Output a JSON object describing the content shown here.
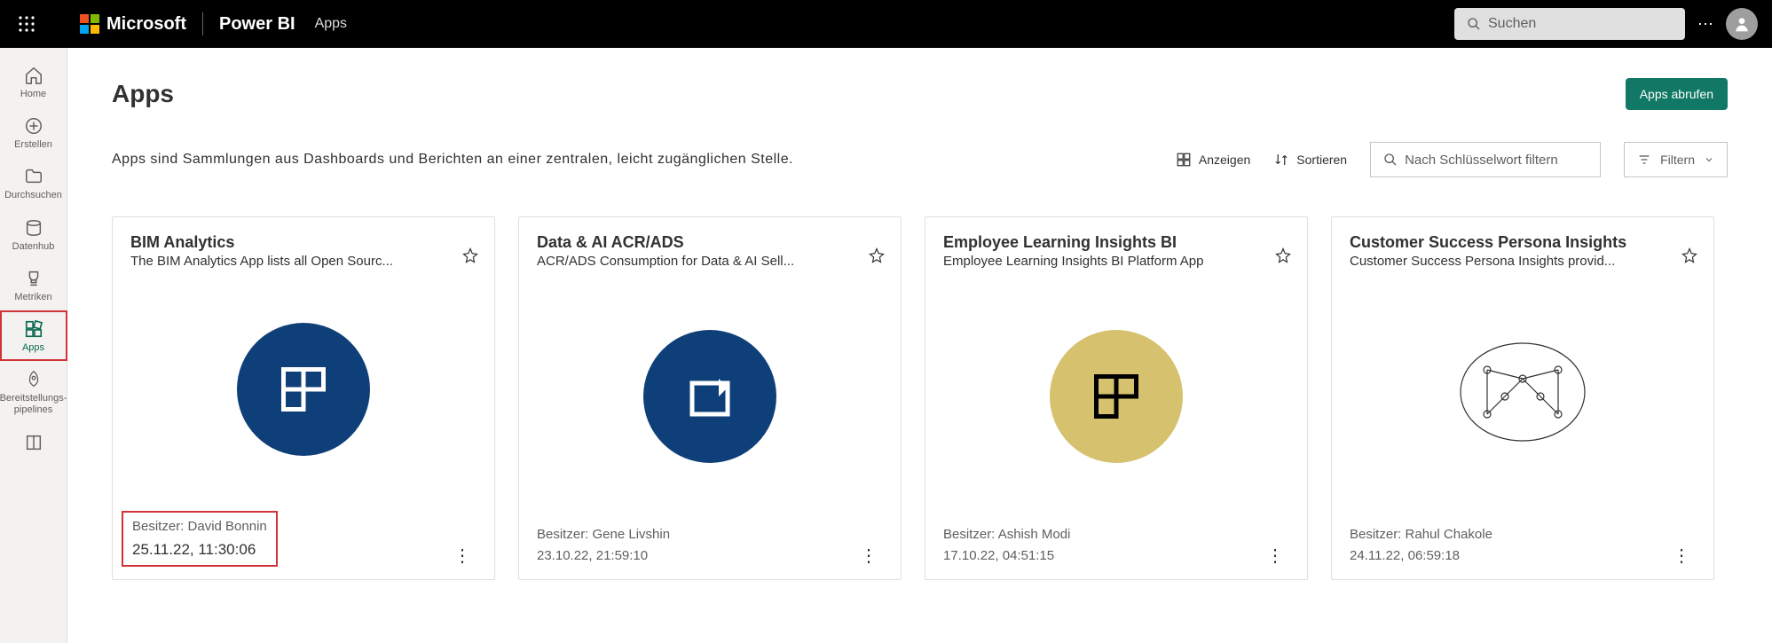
{
  "topbar": {
    "brand": "Microsoft",
    "product": "Power BI",
    "section": "Apps",
    "search_placeholder": "Suchen"
  },
  "rail": {
    "home": "Home",
    "create": "Erstellen",
    "browse": "Durchsuchen",
    "datahub": "Datenhub",
    "metrics": "Metriken",
    "apps": "Apps",
    "pipelines": "Bereitstellungs-\npipelines"
  },
  "page": {
    "title": "Apps",
    "get_apps": "Apps abrufen",
    "description": "Apps sind Sammlungen aus Dashboards und Berichten an einer zentralen, leicht zugänglichen Stelle.",
    "view_label": "Anzeigen",
    "sort_label": "Sortieren",
    "keyword_placeholder": "Nach Schlüsselwort filtern",
    "filter_label": "Filtern"
  },
  "cards": [
    {
      "title": "BIM Analytics",
      "subtitle": "The BIM Analytics App lists all Open Sourc...",
      "owner": "Besitzer: David Bonnin",
      "timestamp": "25.11.22, 11:30:06",
      "highlight": true,
      "thumb": "blue-grid"
    },
    {
      "title": "Data & AI ACR/ADS",
      "subtitle": "ACR/ADS Consumption for Data & AI Sell...",
      "owner": "Besitzer: Gene Livshin",
      "timestamp": "23.10.22, 21:59:10",
      "highlight": false,
      "thumb": "blue-box"
    },
    {
      "title": "Employee Learning Insights BI",
      "subtitle": "Employee Learning Insights BI Platform App",
      "owner": "Besitzer: Ashish Modi",
      "timestamp": "17.10.22, 04:51:15",
      "highlight": false,
      "thumb": "gold-grid"
    },
    {
      "title": "Customer Success Persona Insights",
      "subtitle": "Customer Success Persona Insights provid...",
      "owner": "Besitzer: Rahul Chakole",
      "timestamp": "24.11.22, 06:59:18",
      "highlight": false,
      "thumb": "brain"
    }
  ]
}
